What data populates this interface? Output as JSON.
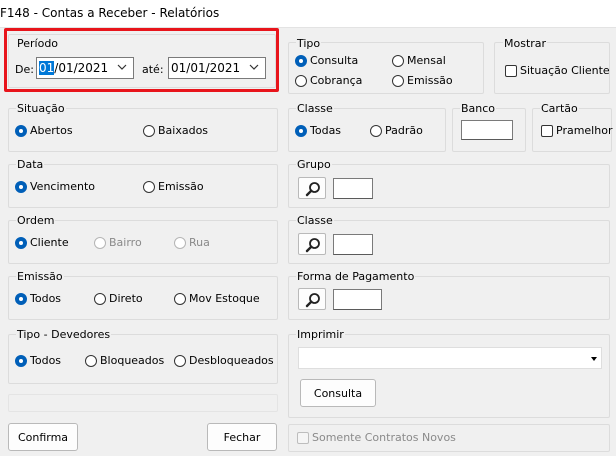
{
  "window": {
    "title": "F148 - Contas a Receber - Relatórios"
  },
  "periodo": {
    "label": "Período",
    "de_label": "De:",
    "de_value_selected": "01",
    "de_value_rest": "/01/2021",
    "ate_label": "até:",
    "ate_value": "01/01/2021"
  },
  "tipo": {
    "label": "Tipo",
    "options": [
      "Consulta",
      "Mensal",
      "Cobrança",
      "Emissão"
    ],
    "selected": "Consulta"
  },
  "mostrar": {
    "label": "Mostrar",
    "checkbox": "Situação Cliente"
  },
  "situacao": {
    "label": "Situação",
    "options": [
      "Abertos",
      "Baixados"
    ],
    "selected": "Abertos"
  },
  "classe_top": {
    "label": "Classe",
    "options": [
      "Todas",
      "Padrão"
    ],
    "selected": "Todas"
  },
  "banco": {
    "label": "Banco",
    "value": ""
  },
  "cartao": {
    "label": "Cartão",
    "checkbox": "Pramelhor"
  },
  "data": {
    "label": "Data",
    "options": [
      "Vencimento",
      "Emissão"
    ],
    "selected": "Vencimento"
  },
  "grupo": {
    "label": "Grupo",
    "value": ""
  },
  "ordem": {
    "label": "Ordem",
    "options": [
      "Cliente",
      "Bairro",
      "Rua"
    ],
    "selected": "Cliente",
    "disabled": [
      "Bairro",
      "Rua"
    ]
  },
  "classe": {
    "label": "Classe",
    "value": ""
  },
  "emissao": {
    "label": "Emissão",
    "options": [
      "Todos",
      "Direto",
      "Mov Estoque"
    ],
    "selected": "Todos"
  },
  "forma_pagamento": {
    "label": "Forma de Pagamento",
    "value": ""
  },
  "tipo_devedores": {
    "label": "Tipo - Devedores",
    "options": [
      "Todos",
      "Bloqueados",
      "Desbloqueados"
    ],
    "selected": "Todos"
  },
  "imprimir": {
    "label": "Imprimir",
    "selected_value": "",
    "button": "Consulta"
  },
  "footer": {
    "confirma": "Confirma",
    "fechar": "Fechar",
    "somente_contratos": "Somente Contratos Novos"
  },
  "colors": {
    "accent": "#005fb8",
    "highlight": "#e8141b",
    "selection": "#0078d7"
  },
  "icons": {
    "search": "magnifier-icon",
    "dropdown": "chevron-down-icon"
  }
}
